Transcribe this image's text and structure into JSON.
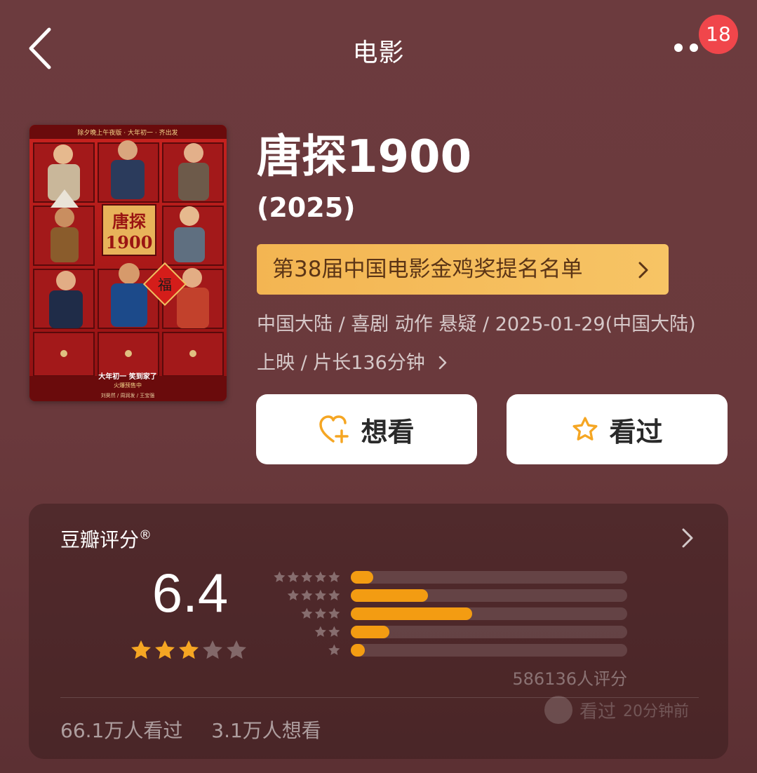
{
  "header": {
    "title": "电影",
    "badge_count": "18"
  },
  "movie": {
    "title": "唐探1900",
    "year": "(2025)",
    "award_banner": "第38届中国电影金鸡奖提名名单",
    "meta_line1": "中国大陆 / 喜剧 动作 悬疑 / 2025-01-29(中国大陆)",
    "meta_line2": "上映 / 片长136分钟"
  },
  "poster": {
    "top_text": "除夕晚上午夜版  ·  大年初一 · 齐出发",
    "logo_line1": "唐探",
    "logo_line2": "1900",
    "fu_char": "福",
    "tagline": "大年初一 笑到家了",
    "sub_tagline": "火爆预售中",
    "cast_line": "刘昊然 / 周润发 / 王宝强"
  },
  "actions": {
    "want_label": "想看",
    "watched_label": "看过"
  },
  "rating": {
    "title": "豆瓣评分",
    "title_mark": "®",
    "score": "6.4",
    "score_stars": 3.2,
    "distribution_percent": [
      8,
      28,
      44,
      14,
      5
    ],
    "count_text": "586136人评分",
    "watched_text": "66.1万人看过",
    "want_text": "3.1万人想看"
  },
  "activity": {
    "label": "看过",
    "time": "20分钟前"
  },
  "colors": {
    "background": "#6a393c",
    "accent_bar": "#f39c12",
    "star": "#f5a623",
    "badge": "#f0464b",
    "banner": "#f5bd5c"
  }
}
